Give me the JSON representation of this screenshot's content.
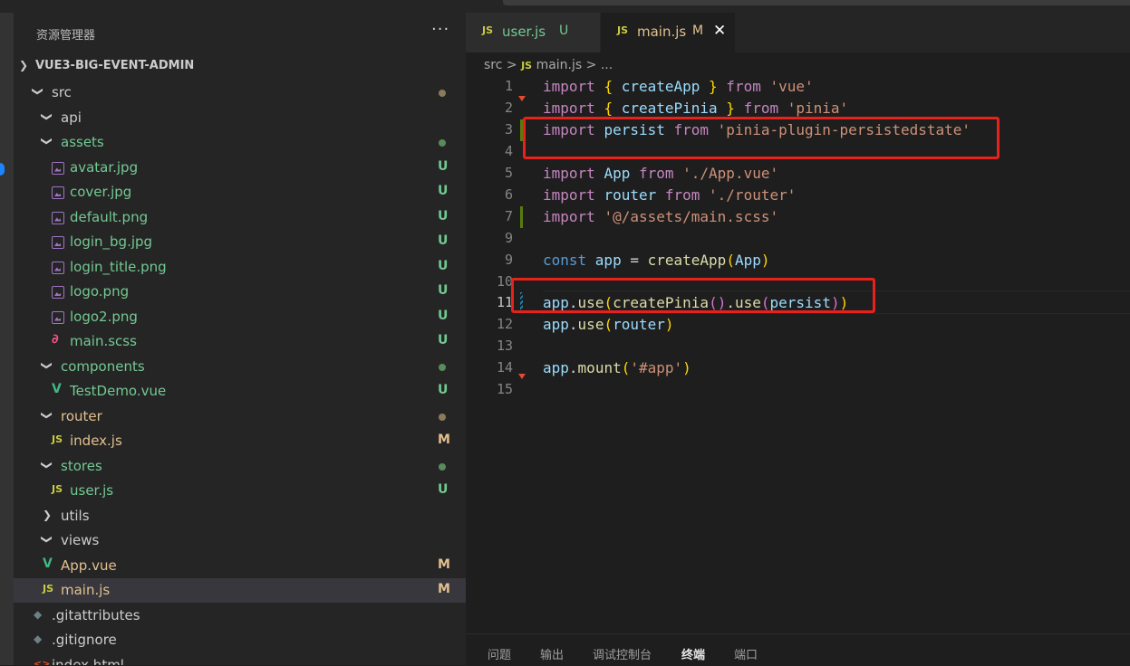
{
  "explorer": {
    "title": "资源管理器",
    "more": "···",
    "project": "VUE3-BIG-EVENT-ADMIN",
    "rows": [
      {
        "name": "src",
        "type": "folder",
        "open": true,
        "badge": "",
        "dot": "#8b7b5a",
        "color": "#cccccc"
      },
      {
        "name": "api",
        "type": "folder",
        "open": true,
        "badge": "",
        "dot": "",
        "color": "#cccccc"
      },
      {
        "name": "assets",
        "type": "folder",
        "open": true,
        "badge": "",
        "dot": "#5a8b5a",
        "color": "#73c991"
      },
      {
        "name": "avatar.jpg",
        "type": "image",
        "badge": "U",
        "color": "#73c991"
      },
      {
        "name": "cover.jpg",
        "type": "image",
        "badge": "U",
        "color": "#73c991"
      },
      {
        "name": "default.png",
        "type": "image",
        "badge": "U",
        "color": "#73c991"
      },
      {
        "name": "login_bg.jpg",
        "type": "image",
        "badge": "U",
        "color": "#73c991"
      },
      {
        "name": "login_title.png",
        "type": "image",
        "badge": "U",
        "color": "#73c991"
      },
      {
        "name": "logo.png",
        "type": "image",
        "badge": "U",
        "color": "#73c991"
      },
      {
        "name": "logo2.png",
        "type": "image",
        "badge": "U",
        "color": "#73c991"
      },
      {
        "name": "main.scss",
        "type": "scss",
        "badge": "U",
        "color": "#73c991"
      },
      {
        "name": "components",
        "type": "folder",
        "open": true,
        "badge": "",
        "dot": "#5a8b5a",
        "color": "#73c991"
      },
      {
        "name": "TestDemo.vue",
        "type": "vue",
        "badge": "U",
        "color": "#73c991"
      },
      {
        "name": "router",
        "type": "folder",
        "open": true,
        "badge": "",
        "dot": "#8b7b5a",
        "color": "#e2c08d"
      },
      {
        "name": "index.js",
        "type": "js",
        "badge": "M",
        "color": "#e2c08d"
      },
      {
        "name": "stores",
        "type": "folder",
        "open": true,
        "badge": "",
        "dot": "#5a8b5a",
        "color": "#73c991"
      },
      {
        "name": "user.js",
        "type": "js",
        "badge": "U",
        "color": "#73c991"
      },
      {
        "name": "utils",
        "type": "folder",
        "open": false,
        "badge": "",
        "dot": "",
        "color": "#cccccc"
      },
      {
        "name": "views",
        "type": "folder",
        "open": true,
        "badge": "",
        "dot": "",
        "color": "#cccccc"
      },
      {
        "name": "App.vue",
        "type": "vue",
        "badge": "M",
        "color": "#e2c08d"
      },
      {
        "name": "main.js",
        "type": "js",
        "badge": "M",
        "color": "#e2c08d",
        "selected": true
      },
      {
        "name": ".gitattributes",
        "type": "git",
        "badge": "",
        "color": "#cccccc"
      },
      {
        "name": ".gitignore",
        "type": "git",
        "badge": "",
        "color": "#cccccc"
      },
      {
        "name": "index.html",
        "type": "html",
        "badge": "",
        "color": "#cccccc"
      }
    ]
  },
  "tabs": [
    {
      "name": "user.js",
      "status": "U",
      "icon": "JS",
      "active": false,
      "color": "#73c991"
    },
    {
      "name": "main.js",
      "status": "M",
      "icon": "JS",
      "active": true,
      "color": "#e2c08d",
      "close": "✕"
    }
  ],
  "breadcrumb": {
    "folder": "src",
    "sep": ">",
    "icon": "JS",
    "file": "main.js",
    "more": "..."
  },
  "code": {
    "lines": [
      {
        "n": "1",
        "tokens": [
          [
            "kw",
            "import "
          ],
          [
            "br1",
            "{ "
          ],
          [
            "var",
            "createApp"
          ],
          [
            "br1",
            " }"
          ],
          [
            "kw",
            " from "
          ],
          [
            "str",
            "'vue'"
          ]
        ]
      },
      {
        "n": "2",
        "tokens": [
          [
            "kw",
            "import "
          ],
          [
            "br1",
            "{ "
          ],
          [
            "var",
            "createPinia"
          ],
          [
            "br1",
            " }"
          ],
          [
            "kw",
            " from "
          ],
          [
            "str",
            "'pinia'"
          ]
        ]
      },
      {
        "n": "3",
        "tokens": [
          [
            "kw",
            "import "
          ],
          [
            "var",
            "persist"
          ],
          [
            "kw",
            " from "
          ],
          [
            "str",
            "'pinia-plugin-persistedstate'"
          ]
        ]
      },
      {
        "n": "4",
        "tokens": []
      },
      {
        "n": "5",
        "tokens": [
          [
            "kw",
            "import "
          ],
          [
            "var",
            "App"
          ],
          [
            "kw",
            " from "
          ],
          [
            "str",
            "'./App.vue'"
          ]
        ]
      },
      {
        "n": "6",
        "tokens": [
          [
            "kw",
            "import "
          ],
          [
            "var",
            "router"
          ],
          [
            "kw",
            " from "
          ],
          [
            "str",
            "'./router'"
          ]
        ]
      },
      {
        "n": "7",
        "tokens": [
          [
            "kw",
            "import "
          ],
          [
            "str",
            "'@/assets/main.scss'"
          ]
        ]
      },
      {
        "n": "9",
        "tokens": []
      },
      {
        "n": "9",
        "tokens": [
          [
            "decl",
            "const "
          ],
          [
            "var",
            "app"
          ],
          [
            "plain",
            " = "
          ],
          [
            "fn",
            "createApp"
          ],
          [
            "br1",
            "("
          ],
          [
            "var",
            "App"
          ],
          [
            "br1",
            ")"
          ]
        ]
      },
      {
        "n": "10",
        "tokens": []
      },
      {
        "n": "11",
        "tokens": [
          [
            "var",
            "app"
          ],
          [
            "plain",
            "."
          ],
          [
            "fn",
            "use"
          ],
          [
            "br1",
            "("
          ],
          [
            "fn",
            "createPinia"
          ],
          [
            "br2",
            "()"
          ],
          [
            "plain",
            "."
          ],
          [
            "fn",
            "use"
          ],
          [
            "br2",
            "("
          ],
          [
            "var",
            "persist"
          ],
          [
            "br2",
            ")"
          ],
          [
            "br1",
            ")"
          ]
        ]
      },
      {
        "n": "12",
        "tokens": [
          [
            "var",
            "app"
          ],
          [
            "plain",
            "."
          ],
          [
            "fn",
            "use"
          ],
          [
            "br1",
            "("
          ],
          [
            "var",
            "router"
          ],
          [
            "br1",
            ")"
          ]
        ]
      },
      {
        "n": "13",
        "tokens": []
      },
      {
        "n": "14",
        "tokens": [
          [
            "var",
            "app"
          ],
          [
            "plain",
            "."
          ],
          [
            "fn",
            "mount"
          ],
          [
            "br1",
            "("
          ],
          [
            "str",
            "'#app'"
          ],
          [
            "br1",
            ")"
          ]
        ]
      },
      {
        "n": "15",
        "tokens": []
      }
    ]
  },
  "panel": {
    "tabs": [
      "问题",
      "输出",
      "调试控制台",
      "终端",
      "端口"
    ],
    "active": "终端"
  }
}
